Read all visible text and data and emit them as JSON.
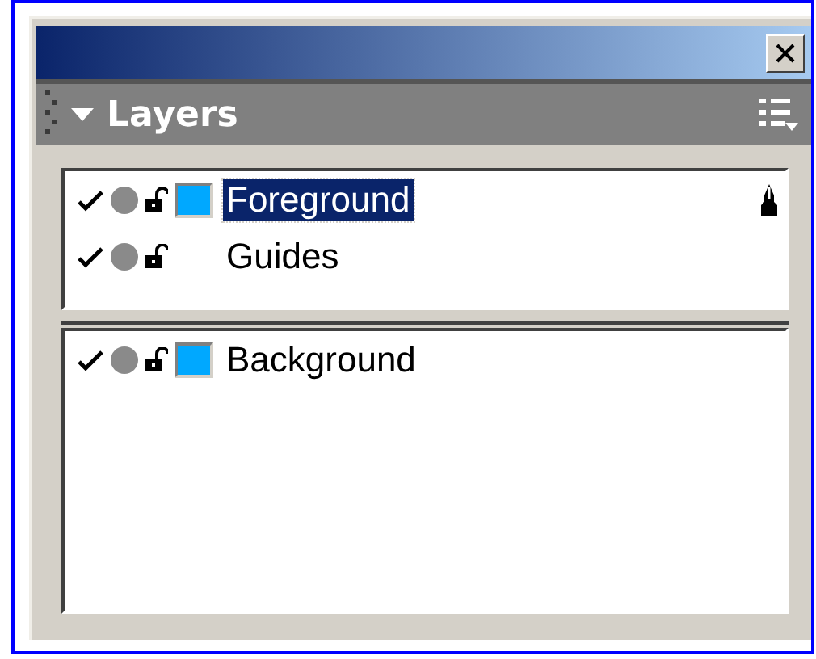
{
  "panel": {
    "title": "Layers",
    "collapsed": false
  },
  "layer_groups": [
    {
      "layers": [
        {
          "name": "Foreground",
          "kind": "layer",
          "color": "#00a8ff",
          "visible": true,
          "locked": false,
          "selected": true,
          "current": true
        },
        {
          "name": "Guides",
          "kind": "guide",
          "visible": true,
          "locked": false,
          "selected": false,
          "current": false
        }
      ]
    },
    {
      "layers": [
        {
          "name": "Background",
          "kind": "layer",
          "color": "#00a8ff",
          "visible": true,
          "locked": false,
          "selected": false,
          "current": false
        }
      ]
    }
  ]
}
